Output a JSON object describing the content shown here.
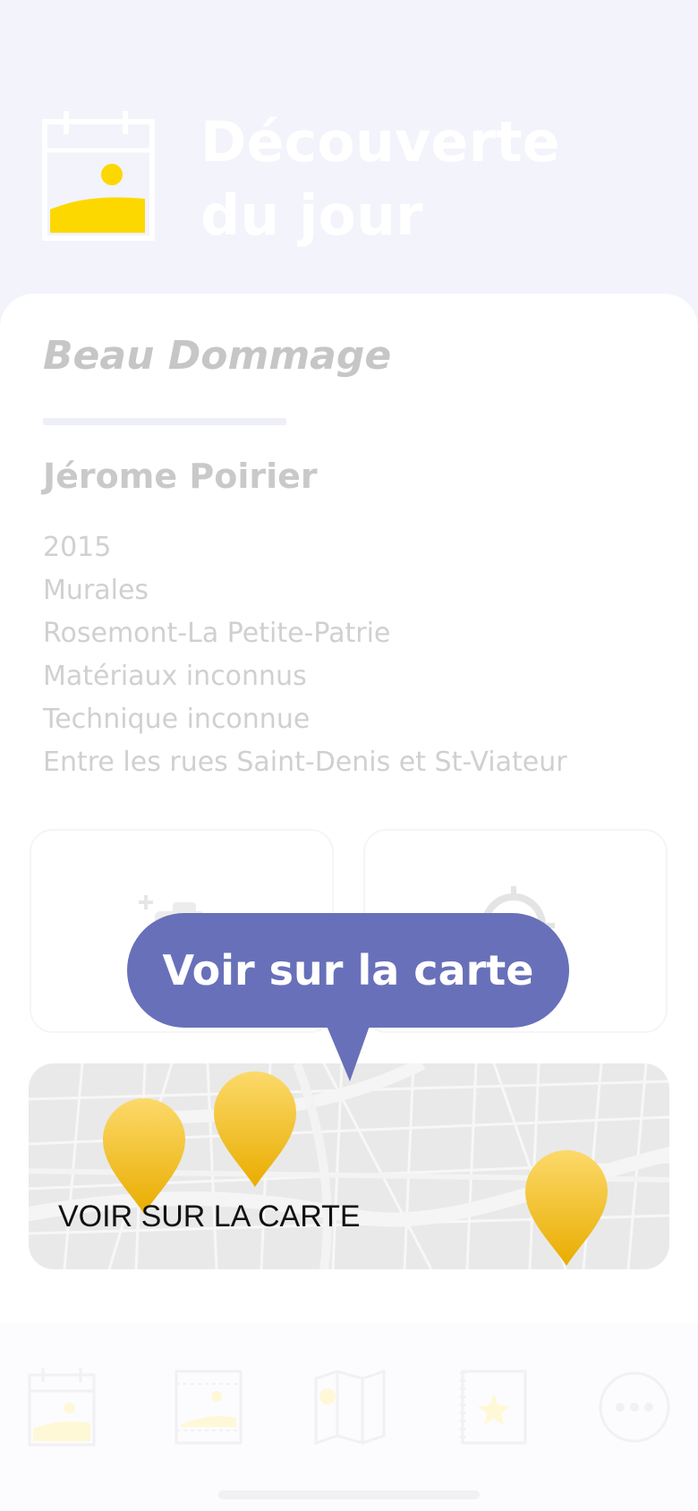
{
  "colors": {
    "header_bg": "#f2f3fb",
    "accent_yellow": "#fcd800",
    "tooltip_bg": "#6870b9",
    "pin_top": "#fcd96a",
    "pin_bottom": "#e9ad00"
  },
  "header": {
    "icon": "calendar-image-icon",
    "title_line1": "Découverte",
    "title_line2": "du jour"
  },
  "artwork": {
    "title": "Beau Dommage",
    "artist": "Jérome Poirier",
    "details": [
      "2015",
      "Murales",
      "Rosemont-La Petite-Patrie",
      "Matériaux inconnus",
      "Technique inconnue",
      "Entre les rues Saint-Denis et St-Viateur"
    ]
  },
  "actions": [
    {
      "icon": "add-photo-icon"
    },
    {
      "icon": "locate-target-icon"
    }
  ],
  "map": {
    "label": "VOIR SUR LA CARTE",
    "pin_icon": "map-pin-icon"
  },
  "tooltip": {
    "text": "Voir sur la carte"
  },
  "tabbar": {
    "items": [
      {
        "icon": "calendar-image-icon"
      },
      {
        "icon": "gallery-icon"
      },
      {
        "icon": "map-icon"
      },
      {
        "icon": "favorites-icon"
      },
      {
        "icon": "more-icon"
      }
    ]
  }
}
